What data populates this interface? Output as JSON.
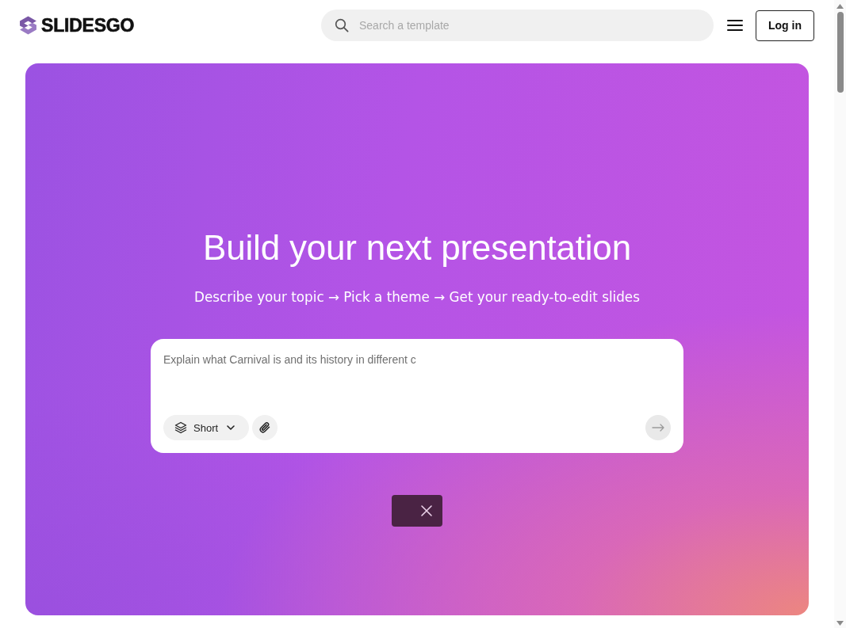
{
  "header": {
    "logo": "SLIDESGO",
    "search": {
      "placeholder": "Search a template"
    },
    "login_button": "Log in"
  },
  "hero": {
    "title": "Build your next presentation",
    "subtitle": "Describe your topic → Pick a theme → Get your ready-to-edit slides",
    "prompt": {
      "placeholder": "Explain what Carnival is and its history in different c",
      "length_option": "Short",
      "send_button": {
        "disabled": true
      }
    }
  }
}
